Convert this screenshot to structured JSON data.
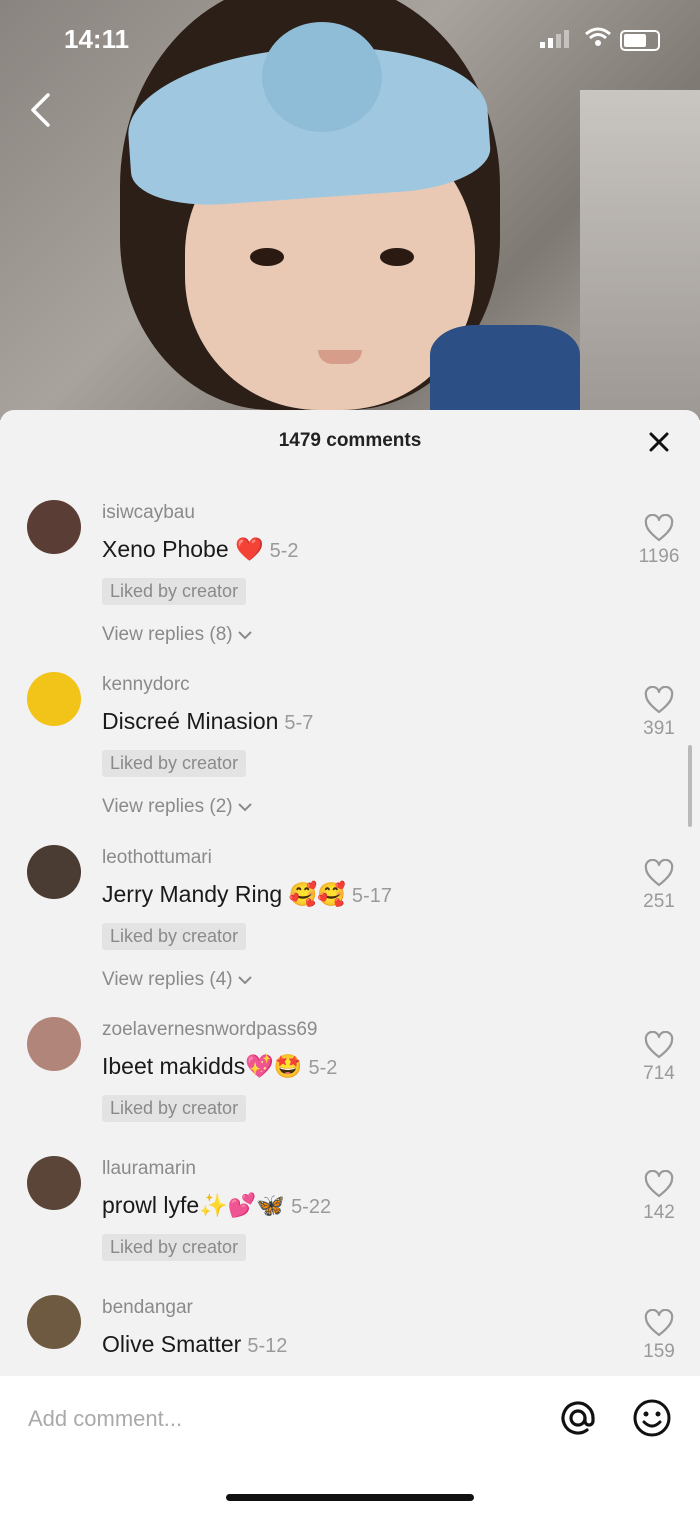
{
  "status_bar": {
    "time": "14:11"
  },
  "sheet": {
    "title": "1479 comments"
  },
  "comments": [
    {
      "username": "isiwcaybau",
      "text": "Xeno Phobe ❤️",
      "date": "5-2",
      "liked_by": "Liked by creator",
      "replies": "View replies (8)",
      "likes": "1196",
      "avatar_color": "#5a3d35"
    },
    {
      "username": "kennydorc",
      "text": "Discreé Minasion",
      "date": "5-7",
      "liked_by": "Liked by creator",
      "replies": "View replies (2)",
      "likes": "391",
      "avatar_color": "#f2c318"
    },
    {
      "username": "leothottumari",
      "text": "Jerry Mandy Ring 🥰🥰",
      "date": "5-17",
      "liked_by": "Liked by creator",
      "replies": "View replies (4)",
      "likes": "251",
      "avatar_color": "#4a3b33"
    },
    {
      "username": "zoelavernesnwordpass69",
      "text": "Ibeet makidds💖🤩",
      "date": "5-2",
      "liked_by": "Liked by creator",
      "replies": "",
      "likes": "714",
      "avatar_color": "#b2857a"
    },
    {
      "username": "llauramarin",
      "text": "prowl lyfe✨💕🦋",
      "date": "5-22",
      "liked_by": "Liked by creator",
      "replies": "",
      "likes": "142",
      "avatar_color": "#5b4538"
    },
    {
      "username": "bendangar",
      "text": "Olive Smatter",
      "date": "5-12",
      "liked_by": "",
      "replies": "",
      "likes": "159",
      "avatar_color": "#6e5a40"
    }
  ],
  "composer": {
    "placeholder": "Add comment..."
  },
  "icons": {
    "back": "chevron-left-icon",
    "close": "close-icon",
    "like": "heart-icon",
    "mention": "at-icon",
    "emoji": "smiley-icon"
  }
}
